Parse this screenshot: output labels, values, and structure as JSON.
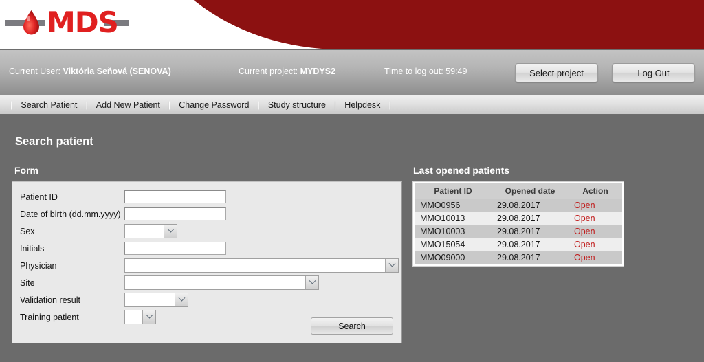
{
  "brand": {
    "logo_text": "MDS",
    "drop_icon": "blood-drop-icon",
    "red_color": "#8c1111",
    "logo_red": "#e02020"
  },
  "header": {
    "current_user_label": "Current User:",
    "current_user_value": "Viktória Seňová (SENOVA)",
    "current_project_label": "Current project:",
    "current_project_value": "MYDYS2",
    "logout_timer_label": "Time to log out:",
    "logout_timer_value": "59:49",
    "select_project_button": "Select project",
    "logout_button": "Log Out"
  },
  "nav": {
    "separator": "|",
    "items": [
      {
        "label": "Search Patient"
      },
      {
        "label": "Add New Patient"
      },
      {
        "label": "Change Password"
      },
      {
        "label": "Study structure"
      },
      {
        "label": "Helpdesk"
      }
    ]
  },
  "main": {
    "page_title": "Search patient",
    "form_heading": "Form",
    "table_heading": "Last opened patients"
  },
  "form": {
    "fields": [
      {
        "label": "Patient ID",
        "type": "text",
        "value": "",
        "placeholder": ""
      },
      {
        "label": "Date of birth (dd.mm.yyyy)",
        "type": "text",
        "value": "",
        "placeholder": ""
      },
      {
        "label": "Sex",
        "type": "select",
        "value": ""
      },
      {
        "label": "Initials",
        "type": "text",
        "value": "",
        "placeholder": ""
      },
      {
        "label": "Physician",
        "type": "select",
        "value": ""
      },
      {
        "label": "Site",
        "type": "select",
        "value": ""
      },
      {
        "label": "Validation result",
        "type": "select",
        "value": ""
      },
      {
        "label": "Training patient",
        "type": "select",
        "value": ""
      }
    ],
    "search_button": "Search"
  },
  "last_opened_patients": {
    "columns": [
      "Patient ID",
      "Opened date",
      "Action"
    ],
    "rows": [
      {
        "patient_id": "MMO0956",
        "opened_date": "29.08.2017",
        "action": "Open"
      },
      {
        "patient_id": "MMO10013",
        "opened_date": "29.08.2017",
        "action": "Open"
      },
      {
        "patient_id": "MMO10003",
        "opened_date": "29.08.2017",
        "action": "Open"
      },
      {
        "patient_id": "MMO15054",
        "opened_date": "29.08.2017",
        "action": "Open"
      },
      {
        "patient_id": "MMO09000",
        "opened_date": "29.08.2017",
        "action": "Open"
      }
    ],
    "action_link_color": "#c01a1a"
  }
}
